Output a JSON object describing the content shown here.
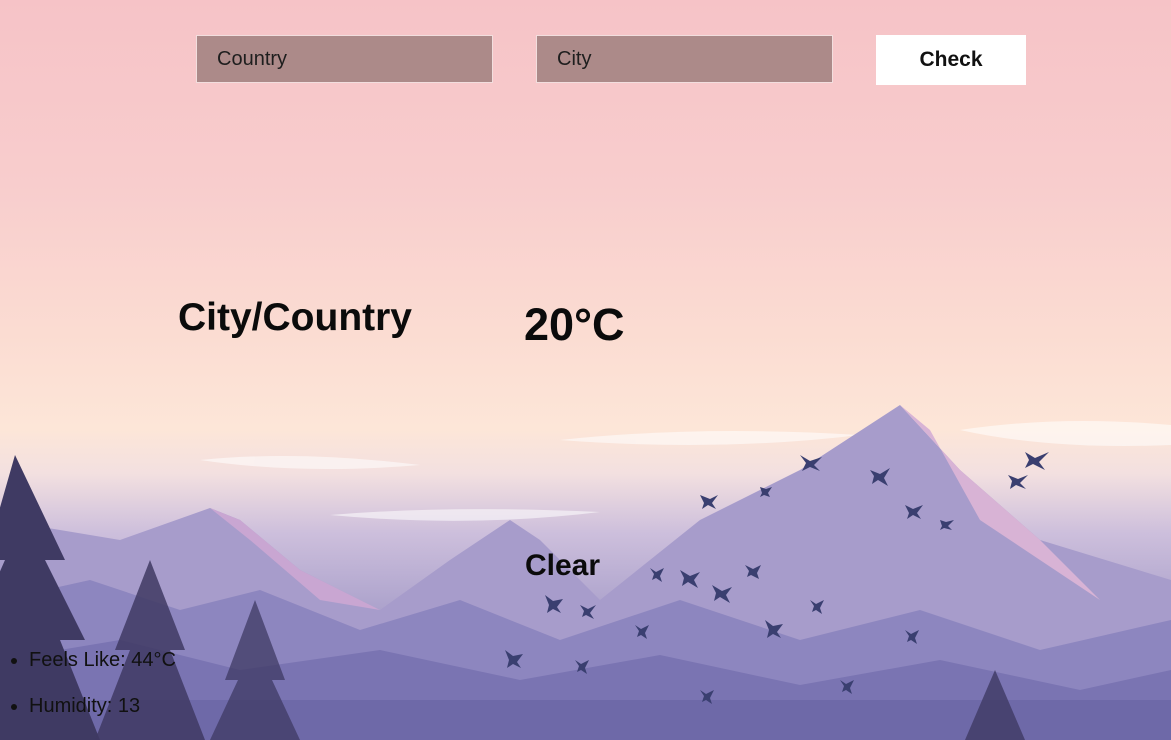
{
  "search": {
    "country_placeholder": "Country",
    "city_placeholder": "City",
    "check_label": "Check"
  },
  "weather": {
    "location": "City/Country",
    "temperature": "20°C",
    "condition": "Clear",
    "feels_like": "Feels Like: 44°C",
    "humidity": "Humidity: 13"
  },
  "colors": {
    "input_bg": "#ac8a89",
    "button_bg": "#ffffff",
    "text": "#0b0b0b"
  }
}
